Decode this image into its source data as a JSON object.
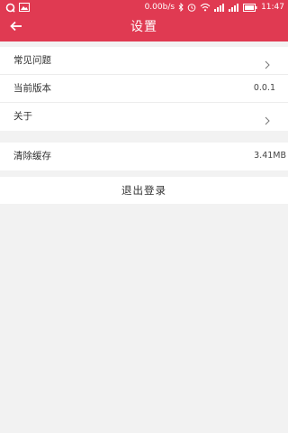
{
  "status_bar": {
    "speed": "0.00b/s",
    "time": "11:47"
  },
  "header": {
    "title": "设置"
  },
  "settings_group": {
    "items": [
      {
        "label": "常见问题",
        "value": ""
      },
      {
        "label": "当前版本",
        "value": "0.0.1"
      },
      {
        "label": "关于",
        "value": ""
      }
    ]
  },
  "cache_group": {
    "label": "清除缓存",
    "value": "3.41MB"
  },
  "logout": {
    "label": "退出登录"
  },
  "colors": {
    "header_bg": "#e03a52",
    "page_bg": "#f2f2f2"
  }
}
